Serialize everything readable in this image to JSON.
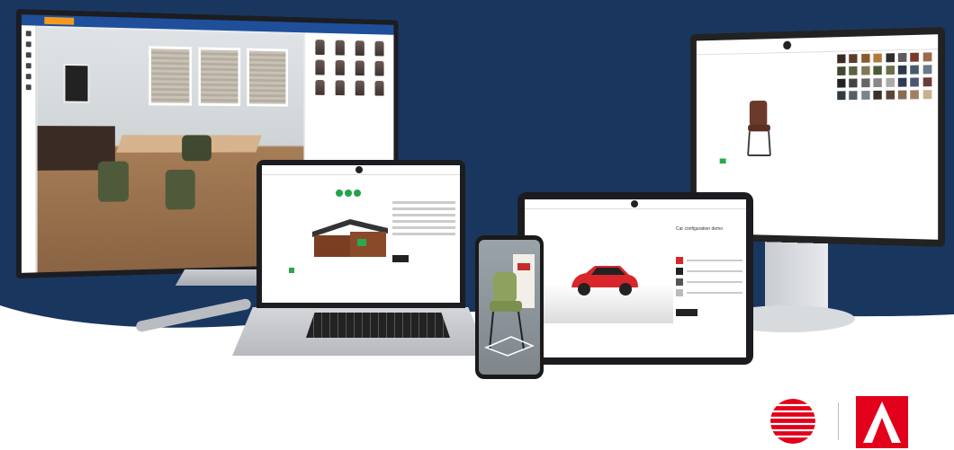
{
  "background": {
    "navy": "#19375e",
    "white": "#ffffff"
  },
  "monitor_left": {
    "toolbar_button": "",
    "panel_title": "",
    "accent": "#1f4f9a",
    "button_color": "#f39a1e"
  },
  "monitor_right": {
    "swatch_colors": [
      "#3a2a24",
      "#5a3d2b",
      "#8a5a2e",
      "#b07a3a",
      "#2d2d2d",
      "#5c5c5c",
      "#7a3a2a",
      "#9b6b4b",
      "#3d4a2e",
      "#5a6340",
      "#7d7a55",
      "#4a5a3a",
      "#6b6f4e",
      "#2e3a45",
      "#475a6b",
      "#6a7a88",
      "#222222",
      "#444444",
      "#666666",
      "#888888",
      "#aaaaaa",
      "#303a55",
      "#4d5670",
      "#6a3b3b",
      "#2f3b3f",
      "#556065",
      "#7b8589",
      "#3e2f2a",
      "#5d4438",
      "#8a6a55",
      "#a08060",
      "#c7b190"
    ]
  },
  "laptop": {
    "product": "garden shed"
  },
  "tablet": {
    "title": "Car configuration demo",
    "car_color": "#d9262b"
  },
  "phone": {
    "product": "green chair"
  },
  "logos": [
    {
      "name": "red-dot-logo"
    },
    {
      "name": "a-design-award-logo"
    }
  ]
}
